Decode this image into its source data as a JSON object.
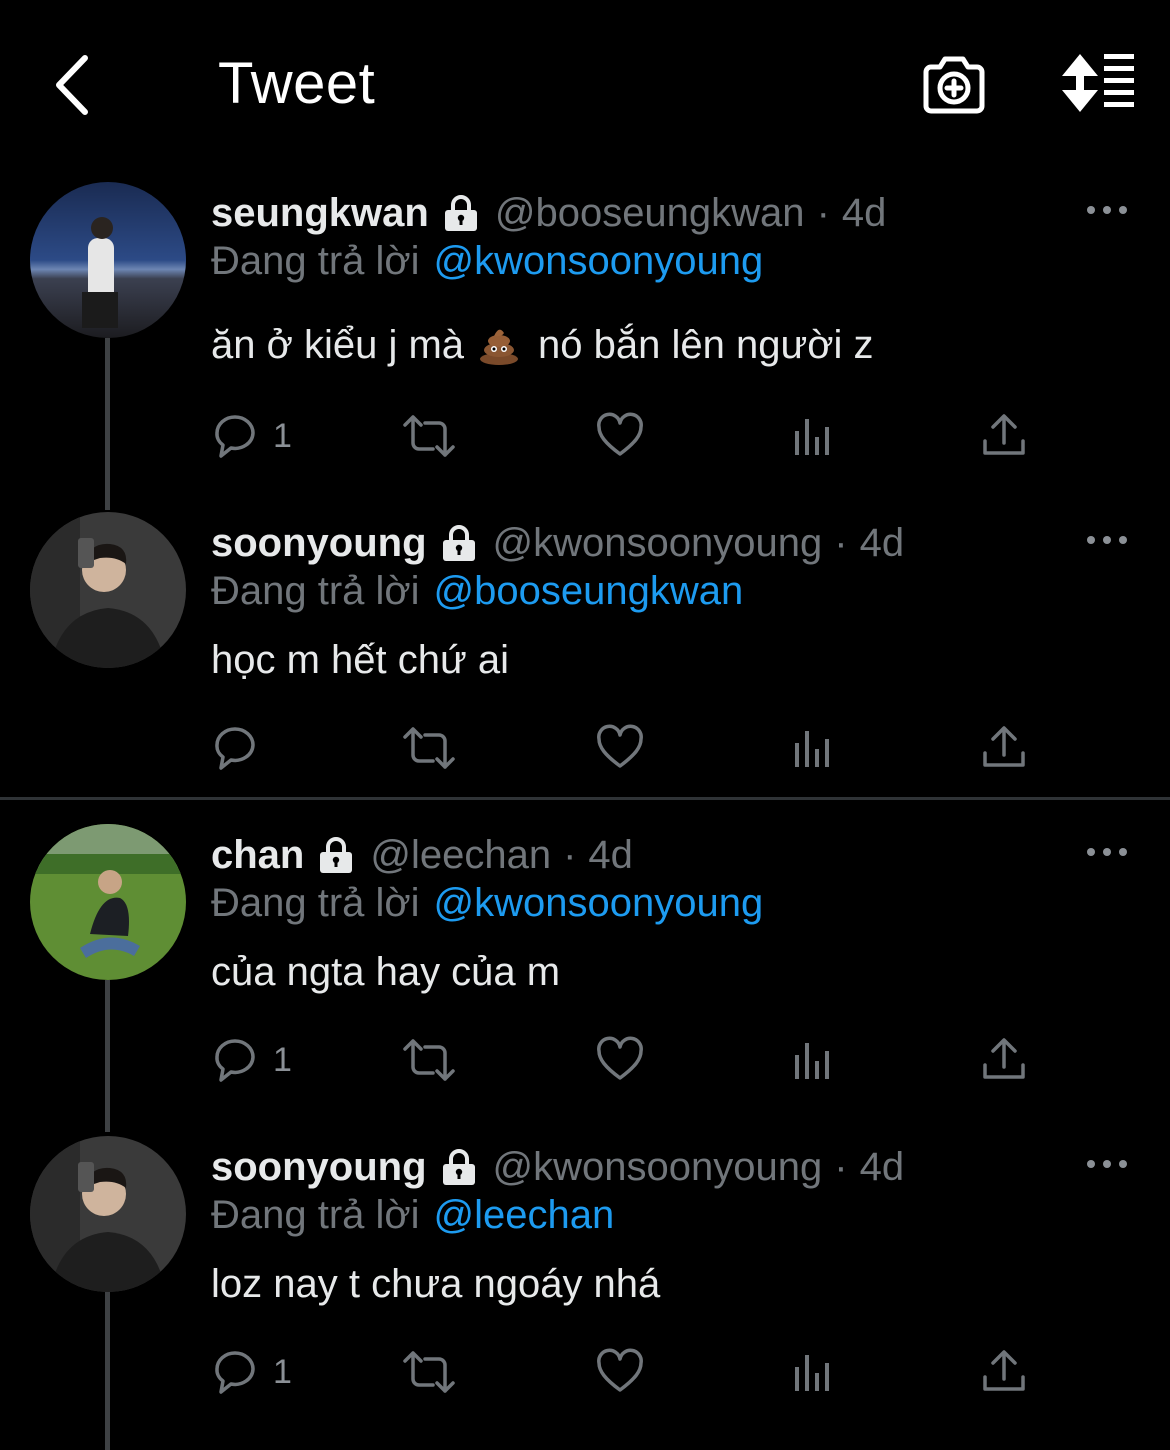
{
  "header": {
    "title": "Tweet"
  },
  "tweets": [
    {
      "name": "seungkwan",
      "handle": "@booseungkwan",
      "sep": "·",
      "time": "4d",
      "reply_label": "Đang trả lời",
      "reply_to": "@kwonsoonyoung",
      "text_a": "ăn ở kiểu j mà",
      "text_b": "nó bắn lên người z",
      "reply_count": "1"
    },
    {
      "name": "soonyoung",
      "handle": "@kwonsoonyoung",
      "sep": "·",
      "time": "4d",
      "reply_label": "Đang trả lời",
      "reply_to": "@booseungkwan",
      "text": "học m hết chứ ai",
      "reply_count": ""
    },
    {
      "name": "chan",
      "handle": "@leechan",
      "sep": "·",
      "time": "4d",
      "reply_label": "Đang trả lời",
      "reply_to": "@kwonsoonyoung",
      "text": "của ngta hay của m",
      "reply_count": "1"
    },
    {
      "name": "soonyoung",
      "handle": "@kwonsoonyoung",
      "sep": "·",
      "time": "4d",
      "reply_label": "Đang trả lời",
      "reply_to": "@leechan",
      "text": "loz nay t chưa ngoáy nhá",
      "reply_count": "1"
    }
  ],
  "icons": {
    "back": "chevron-left-icon",
    "camera": "camera-plus-icon",
    "sort": "sort-icon",
    "lock": "lock-icon",
    "more": "more-horizontal-icon",
    "reply": "reply-icon",
    "retweet": "retweet-icon",
    "like": "heart-icon",
    "views": "analytics-icon",
    "share": "share-icon"
  },
  "colors": {
    "background": "#000000",
    "link": "#1d9bf0",
    "muted": "#71767b"
  }
}
